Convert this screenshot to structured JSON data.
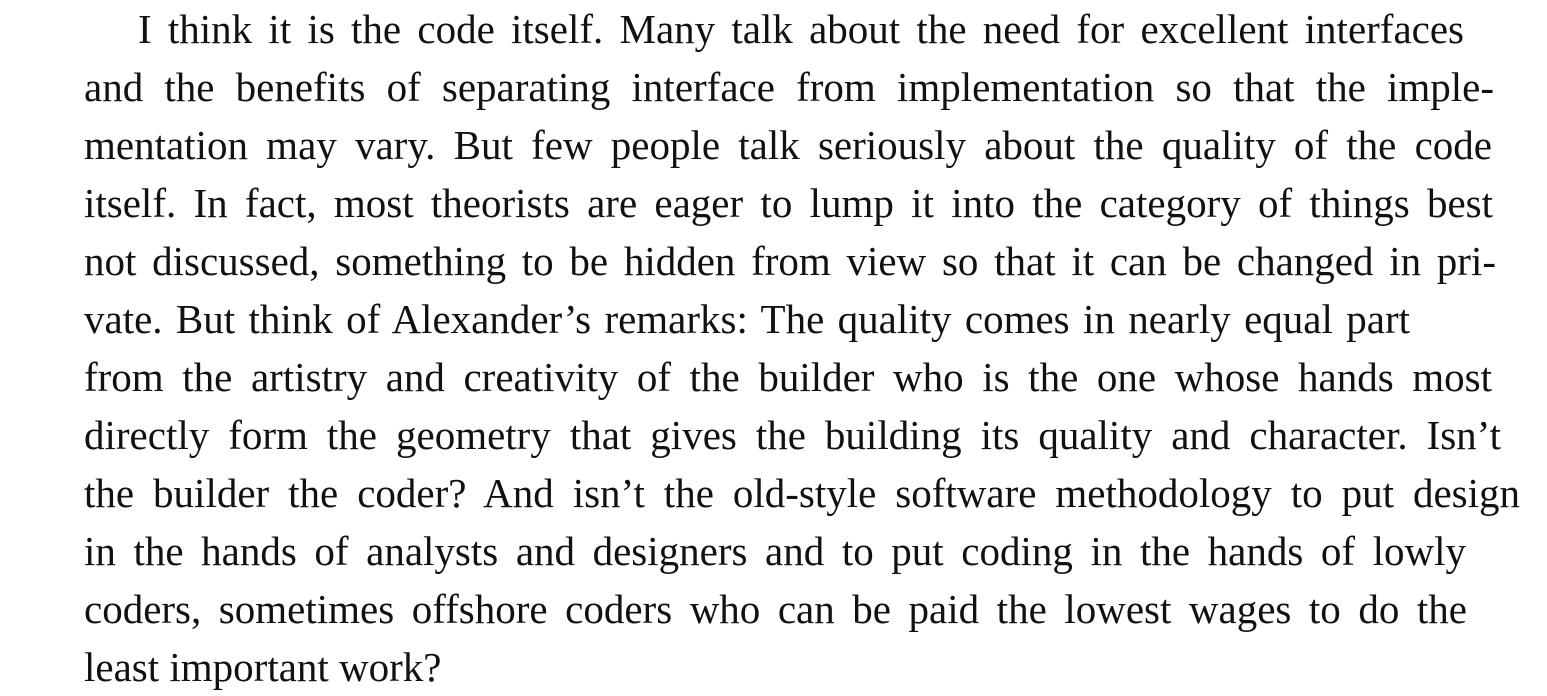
{
  "paragraph": {
    "lines": [
      "I think it is the code itself. Many talk about the need for excellent interfaces",
      "and the benefits of separating interface from implementation so that the imple-",
      "mentation may vary. But few people talk seriously about the quality of the code",
      "itself. In fact, most theorists are eager to lump it into the category of things best",
      "not discussed, something to be hidden from view so that it can be changed in pri-",
      "vate. But think of Alexander’s remarks: The quality comes in nearly equal part",
      "from the artistry and creativity of the builder who is the one whose hands most",
      "directly form the geometry that gives the building its quality and character. Isn’t",
      "the builder the coder? And isn’t the old-style software methodology to put design",
      "in the hands of analysts and designers and to put coding in the hands of lowly",
      "coders, sometimes offshore coders who can be paid the lowest wages to do the",
      "least important work?"
    ]
  }
}
